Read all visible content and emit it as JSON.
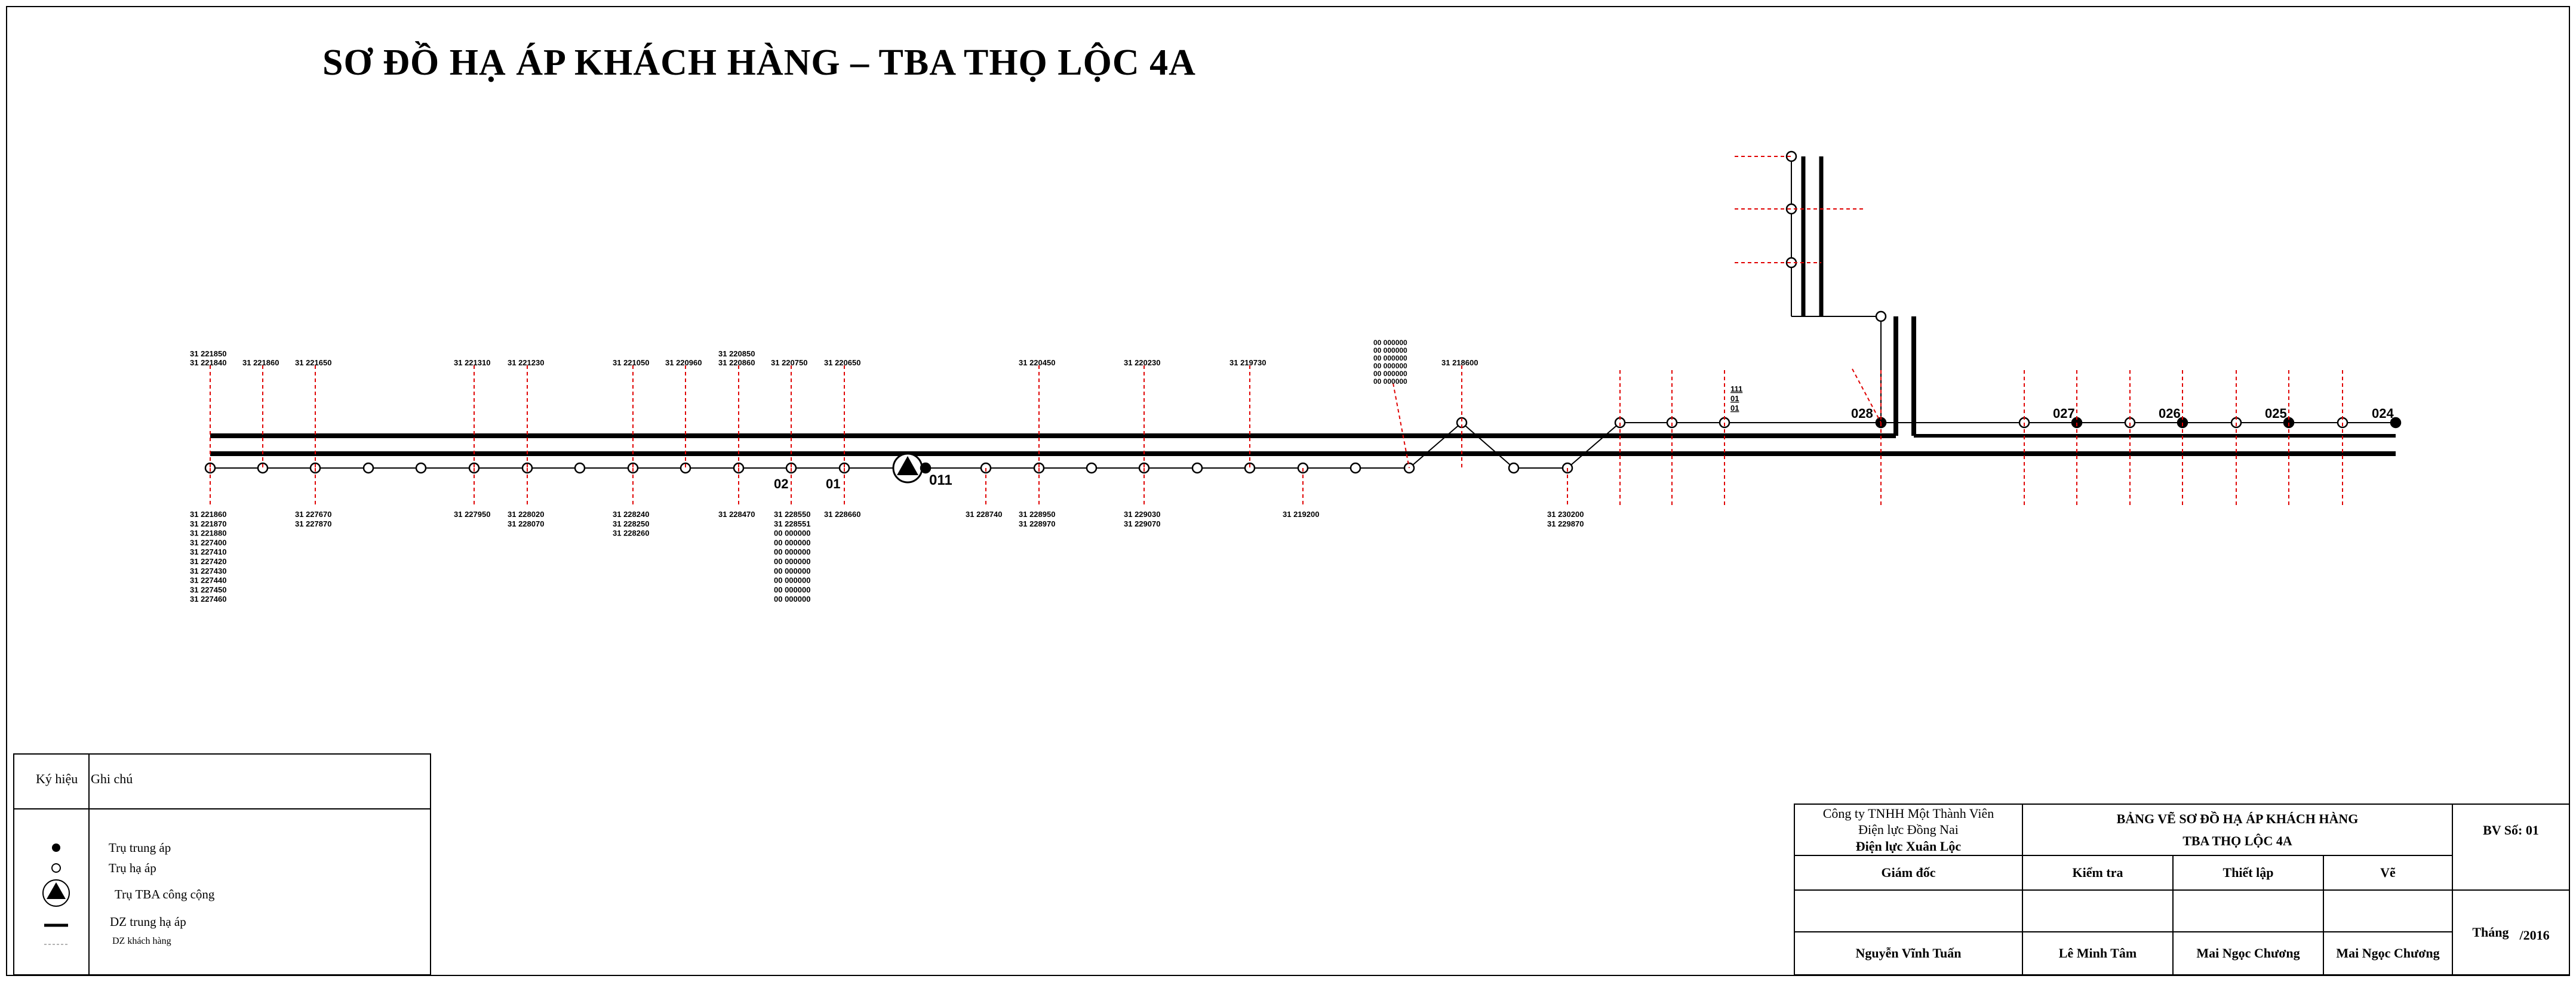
{
  "title": "SƠ ĐỒ HẠ ÁP KHÁCH HÀNG – TBA THỌ LỘC 4A",
  "diagram": {
    "substation_label": "011",
    "pole_labels": [
      "02",
      "01",
      "028",
      "027",
      "026",
      "025",
      "024"
    ],
    "meter_groups_above": [
      [
        "31",
        "221850",
        "31",
        "221840"
      ],
      [
        "31",
        "221860"
      ],
      [
        "31",
        "221650"
      ],
      [
        "31",
        "221310"
      ],
      [
        "31",
        "221230"
      ],
      [
        "31",
        "221050"
      ],
      [
        "31",
        "220960"
      ],
      [
        "31",
        "220850",
        "31",
        "220860"
      ],
      [
        "31",
        "220750"
      ],
      [
        "31",
        "220650"
      ],
      [
        "31",
        "220450"
      ],
      [
        "31",
        "220230"
      ],
      [
        "31",
        "219730"
      ],
      [
        "31",
        "218600"
      ]
    ],
    "meter_groups_below": [
      [
        "31 221860",
        "31 221870",
        "31 221880",
        "31 227400",
        "31 227410",
        "31 227420",
        "31 227430",
        "31 227440",
        "31 227450",
        "31 227460"
      ],
      [
        "31 227670",
        "31 227870"
      ],
      [
        "31 227950"
      ],
      [
        "31 228020",
        "31 228070"
      ],
      [
        "31 228240",
        "31 228250",
        "31 228260"
      ],
      [
        "31 228470"
      ],
      [
        "31 228550",
        "31 228551",
        "00 000000",
        "00 000000",
        "00 000000",
        "00 000000",
        "00 000000",
        "00 000000",
        "00 000000",
        "00 000000"
      ],
      [
        "31 228660"
      ],
      [
        "31 228740"
      ],
      [
        "31 228950",
        "31 228970"
      ],
      [
        "31 229030",
        "31 229070"
      ],
      [
        "31 219200"
      ],
      [
        "31 230200",
        "31 229870"
      ]
    ],
    "meter_group_angled": [
      "00 000000",
      "00 000000",
      "00 000000",
      "00 000000",
      "00 000000",
      "00 000000"
    ],
    "branch_label": [
      "111",
      "01",
      "01"
    ]
  },
  "legend": {
    "col_symbol": "Ký hiệu",
    "col_note": "Ghi chú",
    "items": [
      {
        "symbol": "filled-dot-icon",
        "label": "Trụ trung áp"
      },
      {
        "symbol": "open-circle-icon",
        "label": "Trụ hạ áp"
      },
      {
        "symbol": "substation-triangle-icon",
        "label": "Trụ TBA công cộng"
      },
      {
        "symbol": "thick-line-icon",
        "label": "DZ trung hạ áp"
      },
      {
        "symbol": "dashed-line-icon",
        "label": "DZ khách hàng"
      }
    ]
  },
  "title_block": {
    "company_line1": "Công ty TNHH Một Thành Viên",
    "company_line2": "Điện lực Đồng Nai",
    "company_line3": "Điện lực Xuân Lộc",
    "drawing_title_line1": "BẢNG VẼ SƠ ĐỒ HẠ ÁP KHÁCH HÀNG",
    "drawing_title_line2": "TBA THỌ LỘC 4A",
    "sheet_no": "BV Số: 01",
    "role_director": "Giám đốc",
    "role_check": "Kiểm tra",
    "role_setup": "Thiết lập",
    "role_draw": "Vẽ",
    "month_label": "Tháng",
    "year_label": "/2016",
    "name_director": "Nguyễn Vĩnh Tuấn",
    "name_check": "Lê Minh Tâm",
    "name_setup": "Mai Ngọc Chương",
    "name_draw": "Mai Ngọc Chương"
  },
  "colors": {
    "line": "#000000",
    "customer_line": "#e00000"
  }
}
